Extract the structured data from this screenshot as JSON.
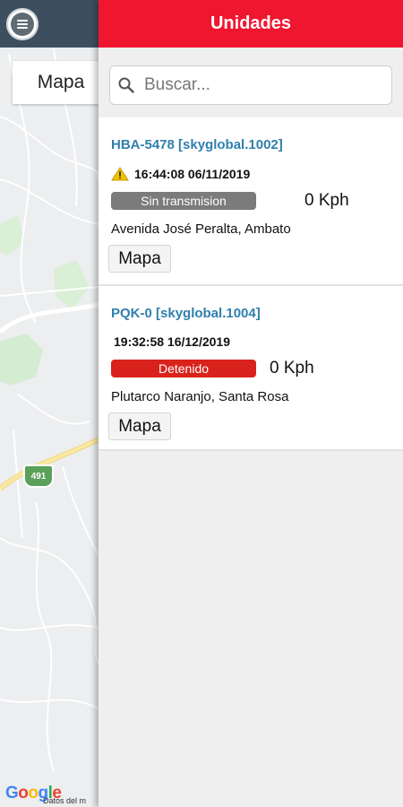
{
  "map": {
    "tab_label": "Mapa",
    "route_number": "491",
    "logo_text": "Google",
    "attribution": "Datos del m"
  },
  "drawer": {
    "title": "Unidades",
    "search_placeholder": "Buscar...",
    "header_color": "#f0162f"
  },
  "units": [
    {
      "title": "HBA-5478 [skyglobal.1002]",
      "warning_icon": "warning-icon",
      "timestamp": "16:44:08 06/11/2019",
      "status": "Sin transmision",
      "status_color": "#7b7b7b",
      "speed": "0 Kph",
      "address": "Avenida José Peralta, Ambato",
      "button": "Mapa"
    },
    {
      "title": "PQK-0 [skyglobal.1004]",
      "timestamp": "19:32:58 16/12/2019",
      "status": "Detenido",
      "status_color": "#d9221c",
      "speed": "0 Kph",
      "address": "Plutarco Naranjo, Santa Rosa",
      "button": "Mapa"
    }
  ]
}
